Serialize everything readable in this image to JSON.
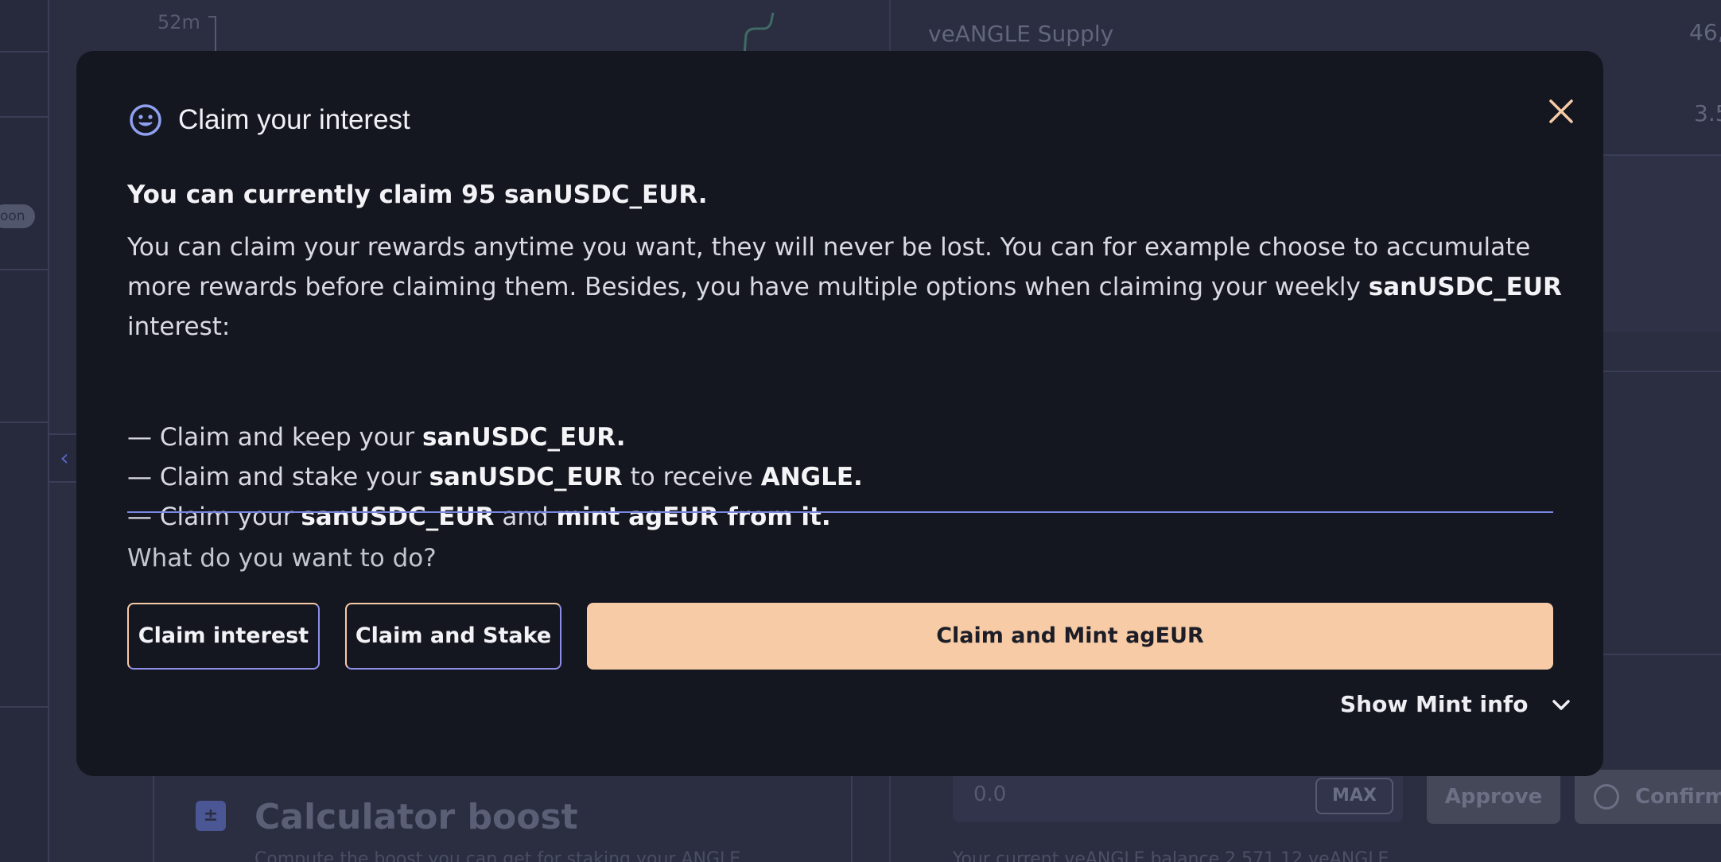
{
  "background": {
    "chart_tick_label": "52m",
    "veangle_label": "veANGLE Supply",
    "veangle_value_1": "46,",
    "veangle_value_2": "3.5",
    "pill_label": "oon",
    "calculator_title": "Calculator boost",
    "calculator_subtitle": "Compute the boost you can get for staking your ANGLE",
    "amount_input": {
      "placeholder": "0.0",
      "max_label": "MAX"
    },
    "approve_label": "Approve",
    "confirm_label": "Confirm",
    "footer_row_text": "Your current veANGLE balance   2,571.12 veANGLE"
  },
  "modal": {
    "title": "Claim your interest",
    "icon": "smile-icon",
    "lead": "You can currently claim 95 sanUSDC_EUR.",
    "description": {
      "part1": "You can claim your rewards anytime you want, they will never be lost. You can for example choose to accumulate more rewards before claiming them. Besides, you have multiple options when claiming your weekly ",
      "token": "sanUSDC_EUR",
      "part2": " interest:"
    },
    "options": [
      {
        "prefix": "— Claim and keep your ",
        "bold1": "sanUSDC_EUR.",
        "middle": "",
        "bold2": ""
      },
      {
        "prefix": "— Claim and stake your ",
        "bold1": "sanUSDC_EUR",
        "middle": " to receive ",
        "bold2": "ANGLE."
      },
      {
        "prefix": "— Claim your ",
        "bold1": "sanUSDC_EUR",
        "middle": " and ",
        "bold2": "mint agEUR from it."
      }
    ],
    "question": "What do you want to do?",
    "buttons": {
      "claim": "Claim interest",
      "stake": "Claim and Stake",
      "mint": "Claim and Mint agEUR"
    },
    "show_info": "Show Mint info",
    "colors": {
      "accent_peach": "#f6cba6",
      "accent_indigo": "#7b86e0",
      "modal_bg": "#151720"
    }
  }
}
